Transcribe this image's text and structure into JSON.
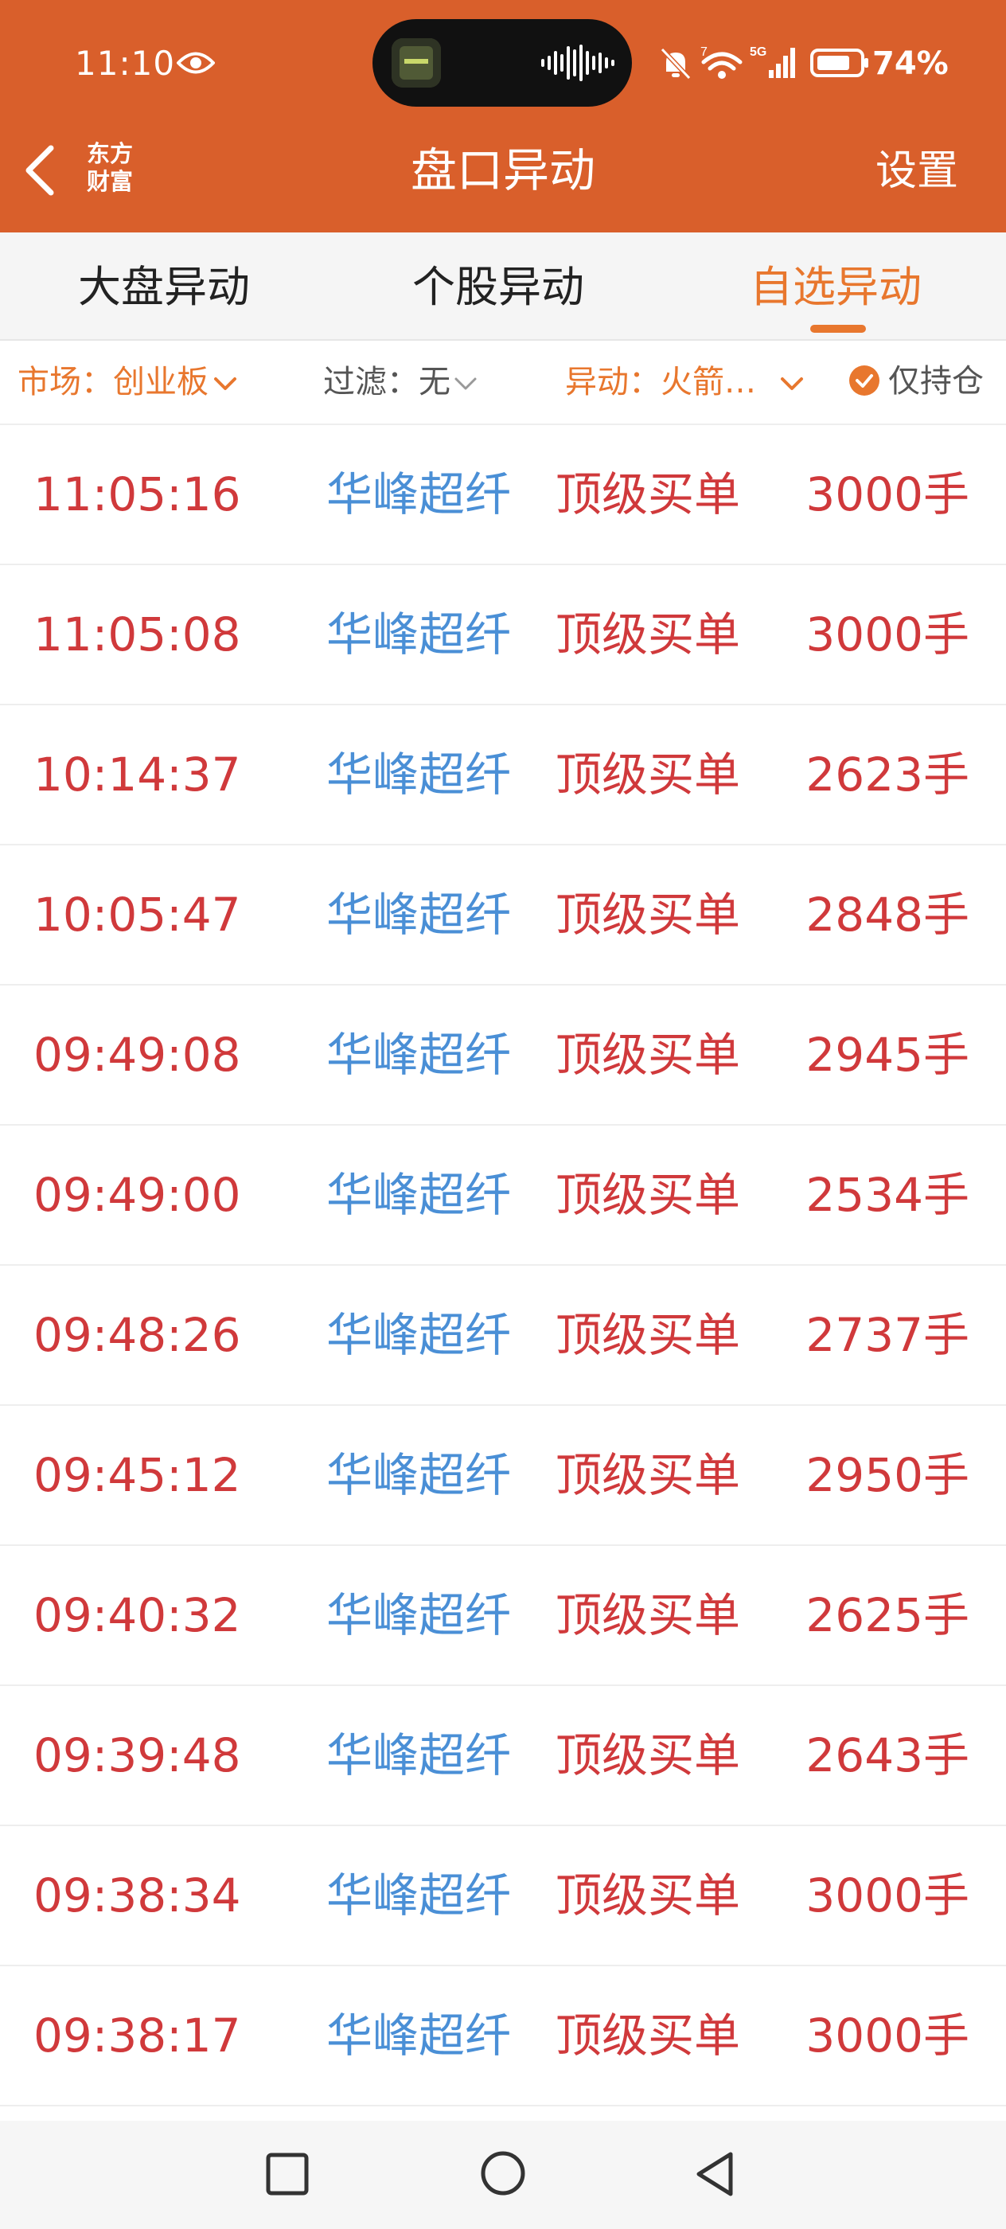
{
  "status_bar": {
    "time": "11:10",
    "battery": "74%",
    "network": "5G"
  },
  "header": {
    "brand_line1": "东方",
    "brand_line2": "财富",
    "title": "盘口异动",
    "settings_label": "设置"
  },
  "tabs": [
    {
      "label": "大盘异动",
      "active": false
    },
    {
      "label": "个股异动",
      "active": false
    },
    {
      "label": "自选异动",
      "active": true
    }
  ],
  "filters": {
    "market": "市场：创业板",
    "filter": "过滤：无",
    "alert": "异动：火箭…",
    "holdings_only_label": "仅持仓",
    "holdings_only_checked": true
  },
  "rows": [
    {
      "time": "11:05:16",
      "name": "华峰超纤",
      "type": "顶级买单",
      "volume": "3000手"
    },
    {
      "time": "11:05:08",
      "name": "华峰超纤",
      "type": "顶级买单",
      "volume": "3000手"
    },
    {
      "time": "10:14:37",
      "name": "华峰超纤",
      "type": "顶级买单",
      "volume": "2623手"
    },
    {
      "time": "10:05:47",
      "name": "华峰超纤",
      "type": "顶级买单",
      "volume": "2848手"
    },
    {
      "time": "09:49:08",
      "name": "华峰超纤",
      "type": "顶级买单",
      "volume": "2945手"
    },
    {
      "time": "09:49:00",
      "name": "华峰超纤",
      "type": "顶级买单",
      "volume": "2534手"
    },
    {
      "time": "09:48:26",
      "name": "华峰超纤",
      "type": "顶级买单",
      "volume": "2737手"
    },
    {
      "time": "09:45:12",
      "name": "华峰超纤",
      "type": "顶级买单",
      "volume": "2950手"
    },
    {
      "time": "09:40:32",
      "name": "华峰超纤",
      "type": "顶级买单",
      "volume": "2625手"
    },
    {
      "time": "09:39:48",
      "name": "华峰超纤",
      "type": "顶级买单",
      "volume": "2643手"
    },
    {
      "time": "09:38:34",
      "name": "华峰超纤",
      "type": "顶级买单",
      "volume": "3000手"
    },
    {
      "time": "09:38:17",
      "name": "华峰超纤",
      "type": "顶级买单",
      "volume": "3000手"
    }
  ],
  "icons": {
    "back": "back-arrow-icon",
    "eye": "eye-icon",
    "mute": "bell-muted-icon",
    "wifi": "wifi-icon",
    "signal": "cellular-signal-icon",
    "battery": "battery-icon",
    "check": "check-circle-icon",
    "nav_recents": "square-icon",
    "nav_home": "circle-icon",
    "nav_back": "triangle-back-icon"
  },
  "colors": {
    "header_bg": "#D95F2B",
    "accent": "#E8772E",
    "time_red": "#D0393B",
    "stock_blue": "#4A8FD6"
  }
}
